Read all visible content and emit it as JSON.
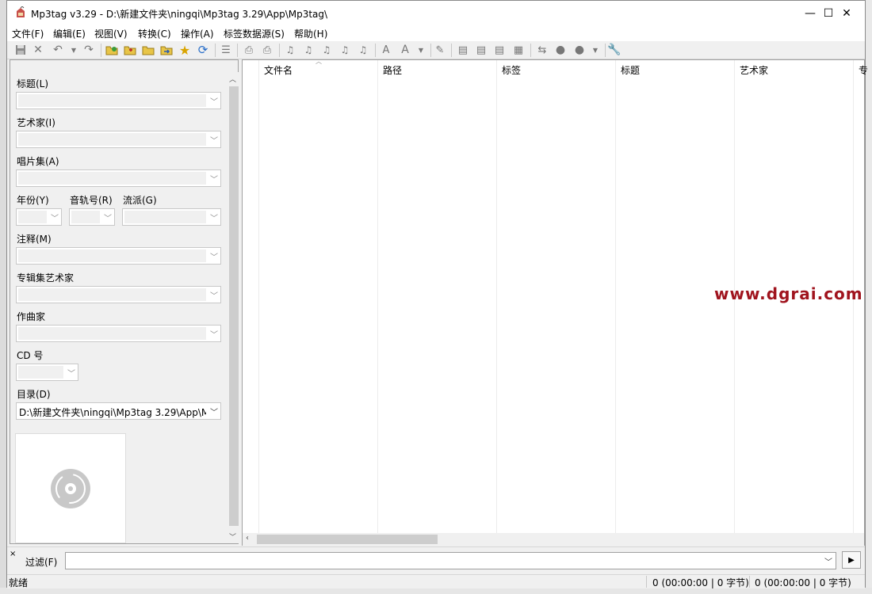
{
  "window": {
    "title": "Mp3tag v3.29  -  D:\\新建文件夹\\ningqi\\Mp3tag 3.29\\App\\Mp3tag\\",
    "minimize": "—",
    "maximize": "☐",
    "close": "✕"
  },
  "menu": [
    "文件(F)",
    "编辑(E)",
    "视图(V)",
    "转换(C)",
    "操作(A)",
    "标签数据源(S)",
    "帮助(H)"
  ],
  "toolbar": [
    "save-icon",
    "remove-tag-icon",
    "undo-icon",
    "undo-dropdown-icon",
    "redo-icon",
    "change-directory-icon",
    "add-directory-icon",
    "open-folder-icon",
    "export-folder-icon",
    "favorite-star-icon",
    "refresh-icon",
    "list-icon",
    "print-icon",
    "print-preview-icon",
    "tag-to-filename-icon",
    "filename-to-tag-icon",
    "tag-to-tag-icon",
    "text-file-to-tag-icon",
    "filename-to-filename-icon",
    "actions-icon",
    "case-conversion-icon",
    "case-dropdown-icon",
    "edit-icon",
    "playlist-icon",
    "export-icon",
    "autonumber-icon",
    "tracknumber-icon",
    "tag-sources-icon",
    "web-icon",
    "web-sources-icon",
    "web-dropdown-icon",
    "options-wrench-icon"
  ],
  "panel": {
    "close": "×",
    "fields": {
      "title": "标题(L)",
      "artist": "艺术家(I)",
      "album": "唱片集(A)",
      "year": "年份(Y)",
      "track": "音轨号(R)",
      "genre": "流派(G)",
      "comment": "注释(M)",
      "album_artist": "专辑集艺术家",
      "composer": "作曲家",
      "cd": "CD 号",
      "directory": "目录(D)"
    },
    "directory_value": "D:\\新建文件夹\\ningqi\\Mp3tag 3.29\\App\\M"
  },
  "columns": [
    "文件名",
    "路径",
    "标签",
    "标题",
    "艺术家",
    "专"
  ],
  "watermark": "www.dgrai.com",
  "filter": {
    "label": "过滤(F)",
    "value": ""
  },
  "status": {
    "left": "就绪",
    "selected": "0 (00:00:00 | 0 字节)",
    "total": "0 (00:00:00 | 0 字节)"
  },
  "colors": {
    "accent": "#a0141e",
    "window": "#f0f0f0"
  }
}
